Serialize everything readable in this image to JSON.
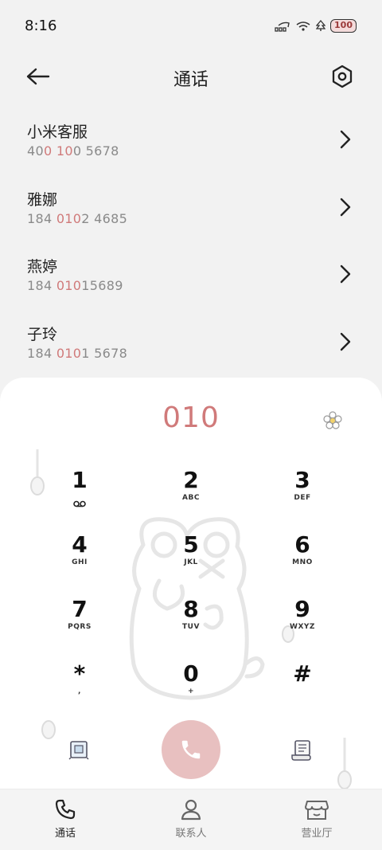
{
  "status": {
    "time": "8:16",
    "battery": "100"
  },
  "header": {
    "title": "通话"
  },
  "results": [
    {
      "name": "小米客服",
      "number_parts": [
        {
          "t": "40",
          "hl": false
        },
        {
          "t": "0",
          "hl": true
        },
        {
          "t": " ",
          "hl": false
        },
        {
          "t": "10",
          "hl": true
        },
        {
          "t": "0 5678",
          "hl": false
        }
      ]
    },
    {
      "name": "雅娜",
      "number_parts": [
        {
          "t": "184 ",
          "hl": false
        },
        {
          "t": "010",
          "hl": true
        },
        {
          "t": "2 4685",
          "hl": false
        }
      ]
    },
    {
      "name": "燕婷",
      "number_parts": [
        {
          "t": "184 ",
          "hl": false
        },
        {
          "t": "010",
          "hl": true
        },
        {
          "t": "15689",
          "hl": false
        }
      ]
    },
    {
      "name": "子玲",
      "number_parts": [
        {
          "t": "184 ",
          "hl": false
        },
        {
          "t": "010",
          "hl": true
        },
        {
          "t": "1 5678",
          "hl": false
        }
      ]
    }
  ],
  "dialpad": {
    "number": "010",
    "keys": [
      {
        "digit": "1",
        "letters": "",
        "voicemail": true
      },
      {
        "digit": "2",
        "letters": "ABC"
      },
      {
        "digit": "3",
        "letters": "DEF"
      },
      {
        "digit": "4",
        "letters": "GHI"
      },
      {
        "digit": "5",
        "letters": "JKL"
      },
      {
        "digit": "6",
        "letters": "MNO"
      },
      {
        "digit": "7",
        "letters": "PQRS"
      },
      {
        "digit": "8",
        "letters": "TUV"
      },
      {
        "digit": "9",
        "letters": "WXYZ"
      },
      {
        "digit": "*",
        "letters": ","
      },
      {
        "digit": "0",
        "letters": "+"
      },
      {
        "digit": "#",
        "letters": ""
      }
    ]
  },
  "nav": [
    {
      "label": "通话",
      "icon": "phone-icon",
      "active": true
    },
    {
      "label": "联系人",
      "icon": "person-icon",
      "active": false
    },
    {
      "label": "营业厅",
      "icon": "store-icon",
      "active": false
    }
  ],
  "colors": {
    "accent": "#d07a7a",
    "call_button": "#e8c0c0",
    "background": "#f2f2f2"
  }
}
